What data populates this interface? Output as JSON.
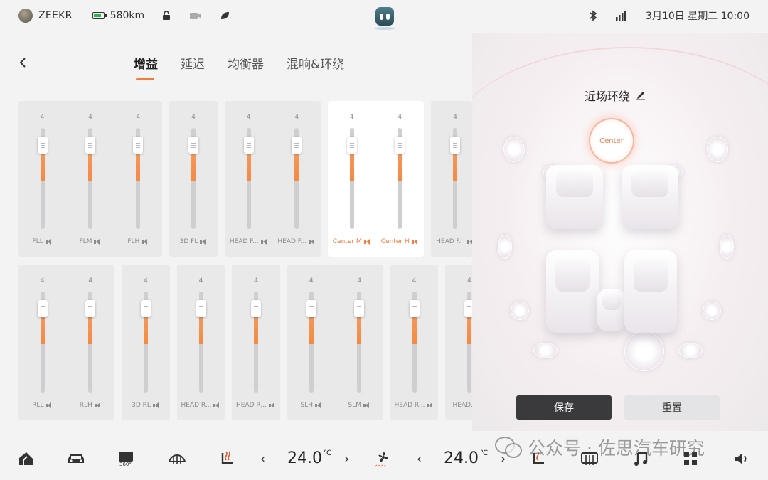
{
  "status": {
    "brand": "ZEEKR",
    "range": "580km",
    "datetime": "3月10日 星期二 10:00",
    "battery_color": "#2db34a"
  },
  "tabs": [
    {
      "label": "增益",
      "active": true
    },
    {
      "label": "延迟",
      "active": false
    },
    {
      "label": "均衡器",
      "active": false
    },
    {
      "label": "混响&环绕",
      "active": false
    }
  ],
  "front_row": [
    {
      "label": "FLL",
      "value": "4"
    },
    {
      "label": "FLM",
      "value": "4"
    },
    {
      "label": "FLH",
      "value": "4"
    },
    {
      "label": "3D FL",
      "value": "4"
    },
    {
      "label": "HEAD F...",
      "value": "4"
    },
    {
      "label": "HEAD F...",
      "value": "4"
    },
    {
      "label": "Center M",
      "value": "4"
    },
    {
      "label": "Center H",
      "value": "4"
    },
    {
      "label": "HEAD F...",
      "value": "4"
    }
  ],
  "rear_row": [
    {
      "label": "RLL",
      "value": "4"
    },
    {
      "label": "RLH",
      "value": "4"
    },
    {
      "label": "3D RL",
      "value": "4"
    },
    {
      "label": "HEAD R...",
      "value": "4"
    },
    {
      "label": "HEAD R...",
      "value": "4"
    },
    {
      "label": "SLH",
      "value": "4"
    },
    {
      "label": "SLM",
      "value": "4"
    },
    {
      "label": "HEAD R...",
      "value": "4"
    },
    {
      "label": "HEAD...",
      "value": "4"
    }
  ],
  "right_panel": {
    "mode_title": "近场环绕",
    "center_label": "Center",
    "save_label": "保存",
    "reset_label": "重置"
  },
  "dock": {
    "temp_left": "24.0",
    "temp_right": "24.0",
    "temp_unit": "℃",
    "prev": "‹",
    "next": "›"
  },
  "watermark": "公众号 · 佐思汽车研究",
  "accent_color": "#f47b3b"
}
